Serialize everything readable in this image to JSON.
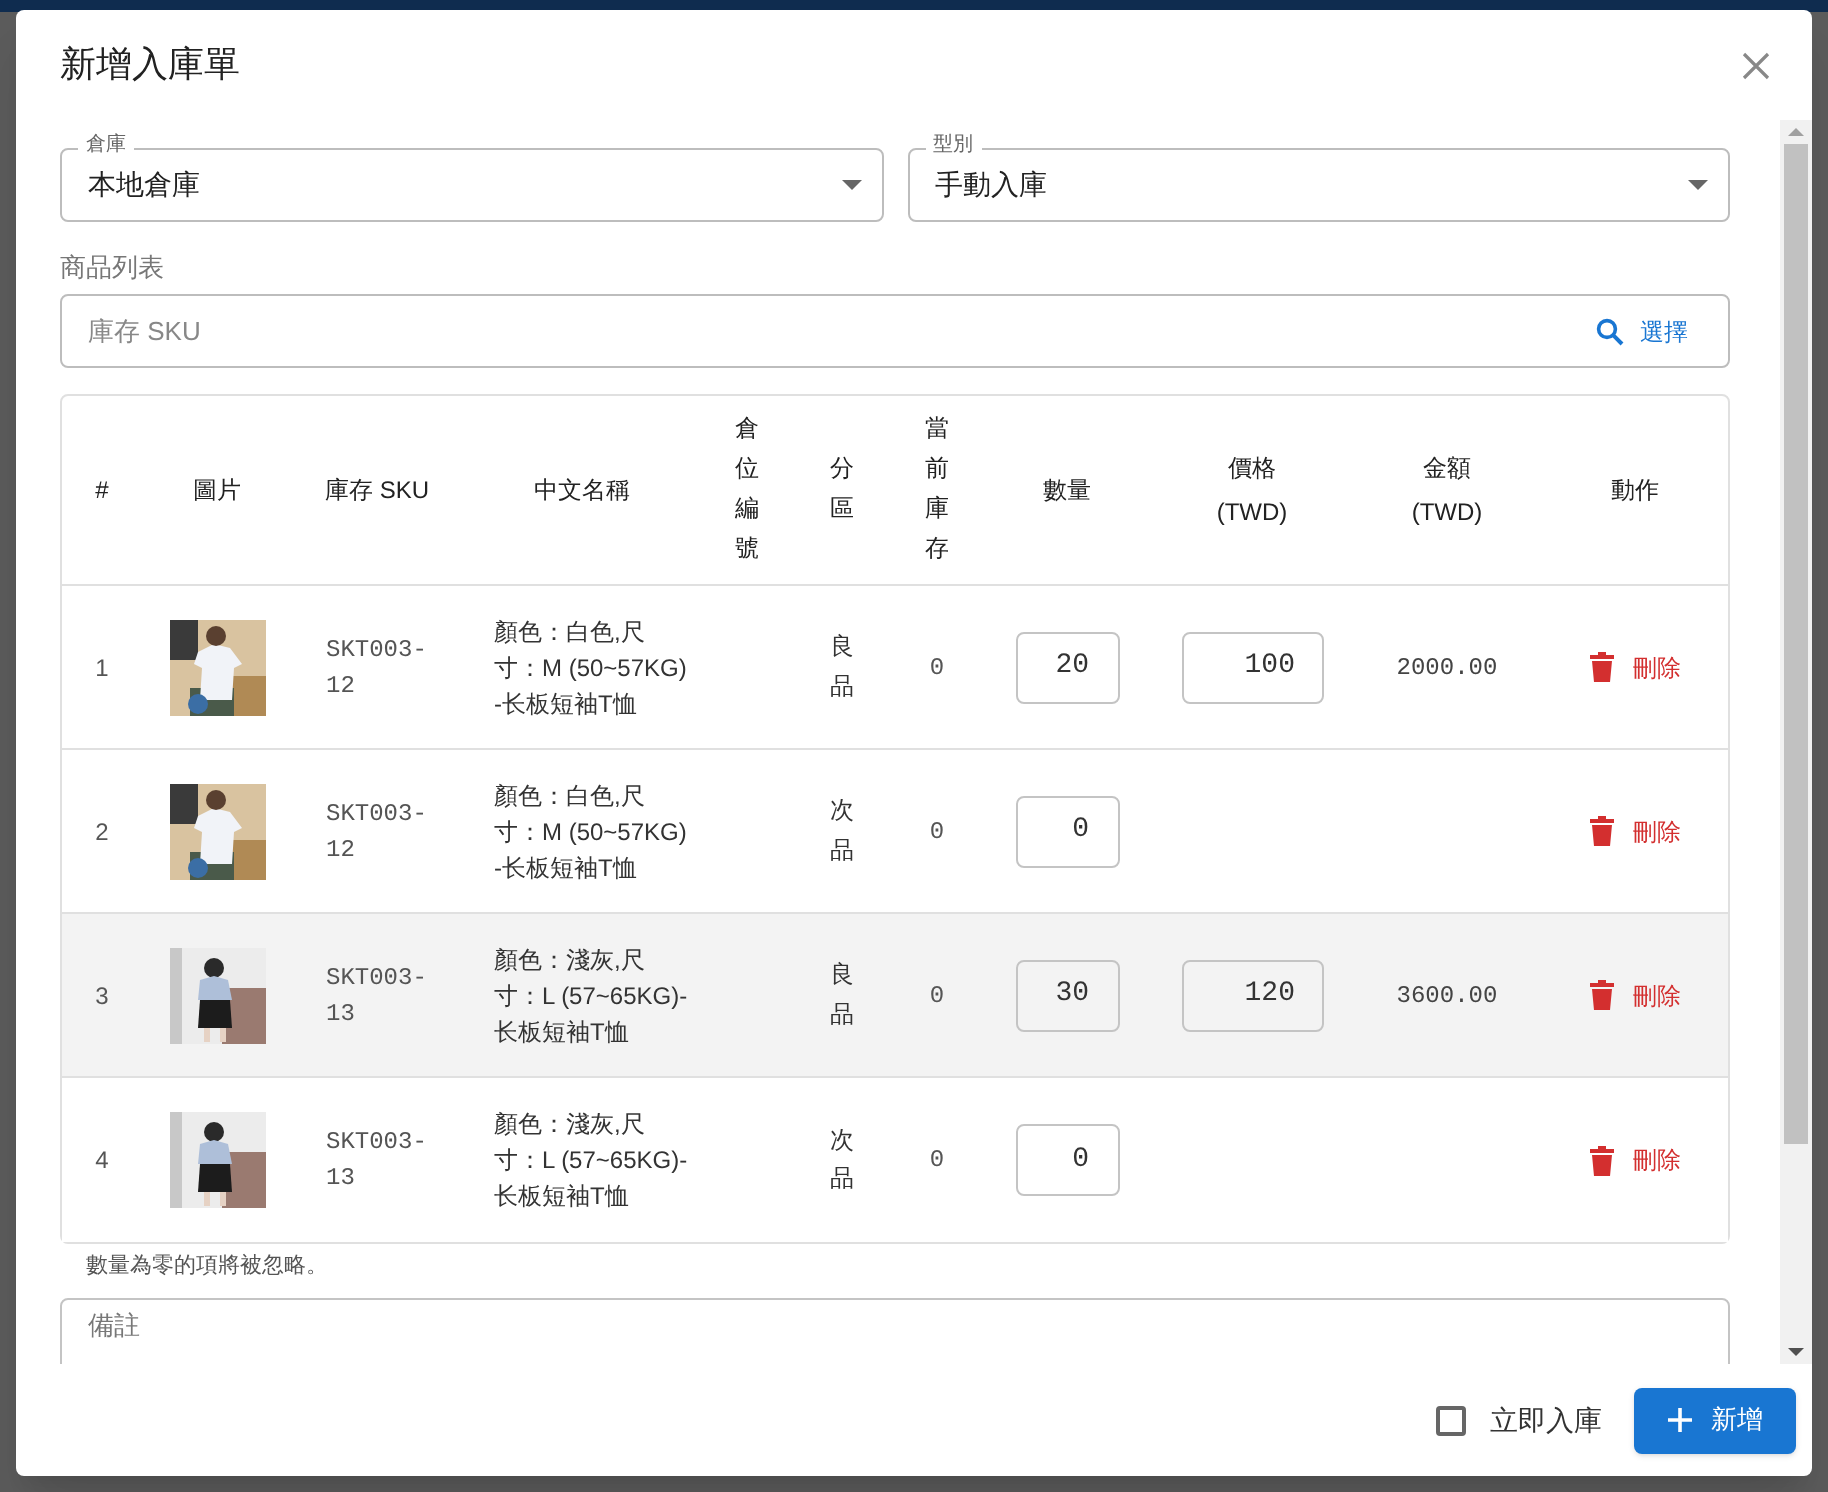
{
  "dialog": {
    "title": "新增入庫單"
  },
  "warehouse": {
    "label": "倉庫",
    "value": "本地倉庫"
  },
  "type": {
    "label": "型別",
    "value": "手動入庫"
  },
  "section_label": "商品列表",
  "sku_search": {
    "placeholder": "庫存 SKU",
    "button": "選擇"
  },
  "table": {
    "columns": [
      {
        "label": "#",
        "vertical": false
      },
      {
        "label": "圖片",
        "vertical": false
      },
      {
        "label": "庫存 SKU",
        "vertical": false
      },
      {
        "label": "中文名稱",
        "vertical": false
      },
      {
        "label": "倉位編號",
        "vertical": true
      },
      {
        "label": "分區",
        "vertical": true
      },
      {
        "label": "當前庫存",
        "vertical": true
      },
      {
        "label": "數量",
        "vertical": false
      },
      {
        "label": "價格",
        "unit": "(TWD)",
        "vertical": false
      },
      {
        "label": "金額",
        "unit": "(TWD)",
        "vertical": false
      },
      {
        "label": "動作",
        "vertical": false
      }
    ],
    "rows": [
      {
        "index": "1",
        "sku": "SKT003-12",
        "name": "顏色：白色,尺寸：M (50~57KG)-长板短袖T恤",
        "zone": "良品",
        "stock": "0",
        "qty": "20",
        "price": "100",
        "amount": "2000.00",
        "action": "刪除",
        "highlighted": false
      },
      {
        "index": "2",
        "sku": "SKT003-12",
        "name": "顏色：白色,尺寸：M (50~57KG)-长板短袖T恤",
        "zone": "次品",
        "stock": "0",
        "qty": "0",
        "action": "刪除",
        "highlighted": false
      },
      {
        "index": "3",
        "sku": "SKT003-13",
        "name": "顏色：淺灰,尺寸：L (57~65KG)-长板短袖T恤",
        "zone": "良品",
        "stock": "0",
        "qty": "30",
        "price": "120",
        "amount": "3600.00",
        "action": "刪除",
        "highlighted": true
      },
      {
        "index": "4",
        "sku": "SKT003-13",
        "name": "顏色：淺灰,尺寸：L (57~65KG)-长板短袖T恤",
        "zone": "次品",
        "stock": "0",
        "qty": "0",
        "action": "刪除",
        "highlighted": false
      }
    ]
  },
  "note": "數量為零的項將被忽略。",
  "remarks": {
    "placeholder": "備註"
  },
  "immediate": {
    "label": "立即入庫",
    "checked": false
  },
  "submit_button": "新增"
}
